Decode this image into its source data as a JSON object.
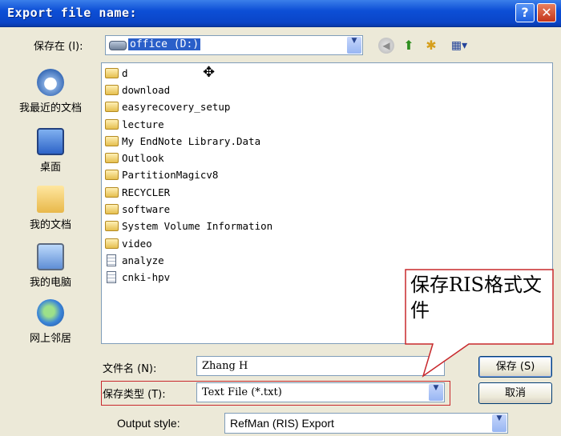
{
  "window": {
    "title": "Export file name:",
    "help_button": "?",
    "close_button": "✕"
  },
  "toolbar": {
    "save_in_label": "保存在 (I):",
    "save_in_value": "office (D:)",
    "icons": [
      "back-icon",
      "up-folder-icon",
      "new-folder-icon",
      "views-menu-icon"
    ]
  },
  "places": [
    {
      "label": "我最近的文档",
      "icon": "recent-documents-icon"
    },
    {
      "label": "桌面",
      "icon": "desktop-icon"
    },
    {
      "label": "我的文档",
      "icon": "my-documents-icon"
    },
    {
      "label": "我的电脑",
      "icon": "my-computer-icon"
    },
    {
      "label": "网上邻居",
      "icon": "network-places-icon"
    }
  ],
  "files": [
    {
      "name": "d",
      "type": "folder"
    },
    {
      "name": "download",
      "type": "folder"
    },
    {
      "name": "easyrecovery_setup",
      "type": "folder"
    },
    {
      "name": "lecture",
      "type": "folder"
    },
    {
      "name": "My EndNote Library.Data",
      "type": "folder"
    },
    {
      "name": "Outlook",
      "type": "folder"
    },
    {
      "name": "PartitionMagicv8",
      "type": "folder"
    },
    {
      "name": "RECYCLER",
      "type": "folder"
    },
    {
      "name": "software",
      "type": "folder"
    },
    {
      "name": "System Volume Information",
      "type": "folder"
    },
    {
      "name": "video",
      "type": "folder"
    },
    {
      "name": "analyze",
      "type": "file"
    },
    {
      "name": "cnki-hpv",
      "type": "file"
    }
  ],
  "form": {
    "filename_label": "文件名 (N):",
    "filename_value": "Zhang H",
    "filetype_label": "保存类型 (T):",
    "filetype_value": "Text File (*.txt)",
    "output_style_label": "Output style:",
    "output_style_value": "RefMan (RIS) Export",
    "save_button": "保存 (S)",
    "cancel_button": "取消"
  },
  "annotation": {
    "callout_text": "保存RIS格式文件",
    "color": "#c8282c"
  }
}
